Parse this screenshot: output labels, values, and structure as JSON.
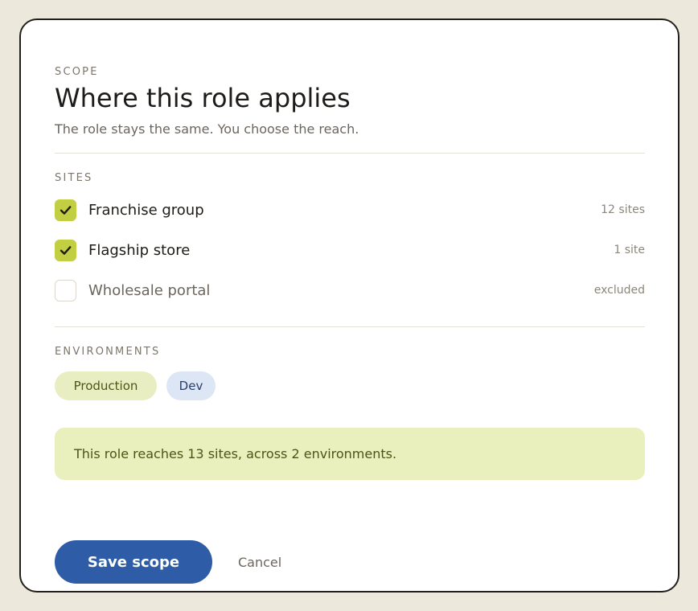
{
  "header": {
    "eyebrow": "SCOPE",
    "title": "Where this role applies",
    "subtitle": "The role stays the same. You choose the reach."
  },
  "sites": {
    "heading": "SITES",
    "items": [
      {
        "label": "Franchise group",
        "meta": "12 sites",
        "checked": true
      },
      {
        "label": "Flagship store",
        "meta": "1 site",
        "checked": true
      },
      {
        "label": "Wholesale portal",
        "meta": "excluded",
        "checked": false
      }
    ]
  },
  "environments": {
    "heading": "ENVIRONMENTS",
    "chips": [
      {
        "label": "Production"
      },
      {
        "label": "Dev"
      }
    ]
  },
  "summary": {
    "text": "This role reaches 13 sites, across 2 environments."
  },
  "actions": {
    "save_label": "Save scope",
    "cancel_label": "Cancel"
  },
  "colors": {
    "page_bg": "#ede8dc",
    "accent_check": "#c3cf43",
    "primary_button": "#2e5ca6",
    "summary_bg": "#eaf0bd",
    "production_chip": "#e9eec2",
    "dev_chip": "#dde6f5"
  }
}
